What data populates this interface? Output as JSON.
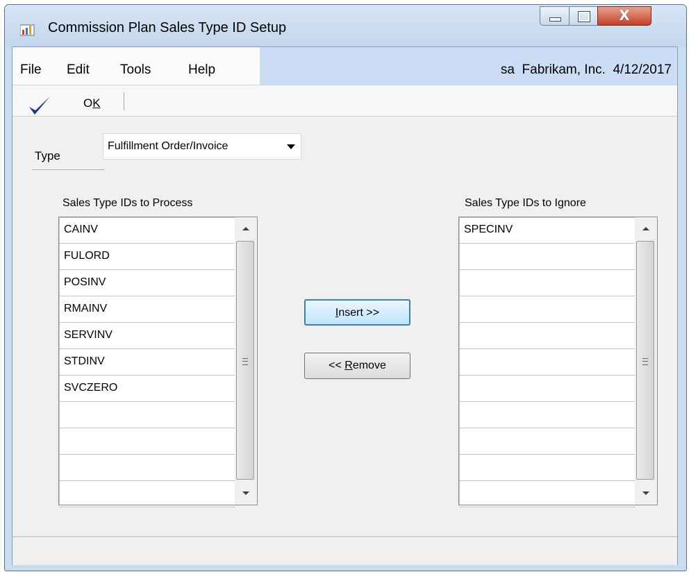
{
  "window": {
    "title": "Commission Plan Sales Type ID Setup",
    "close_glyph": "X",
    "icons": [
      "app-chart-icon",
      "minimize-icon",
      "maximize-icon",
      "close-icon"
    ]
  },
  "menu": {
    "items": [
      "File",
      "Edit",
      "Tools",
      "Help"
    ],
    "company_info": "sa  Fabrikam, Inc.  4/12/2017"
  },
  "toolbar": {
    "ok_label_prefix": "O",
    "ok_label_underlined": "K",
    "ok_icon": "checkmark-icon"
  },
  "form": {
    "type_label": "Type",
    "type_value": "Fulfillment Order/Invoice",
    "process_caption": "Sales Type IDs to Process",
    "ignore_caption": "Sales Type IDs to Ignore",
    "process_items": [
      "CAINV",
      "FULORD",
      "POSINV",
      "RMAINV",
      "SERVINV",
      "STDINV",
      "SVCZERO"
    ],
    "ignore_items": [
      "SPECINV"
    ],
    "insert_button": {
      "underlined": "I",
      "rest": "nsert >>"
    },
    "remove_button": {
      "prefix": "<< ",
      "underlined": "R",
      "rest": "emove"
    }
  },
  "colors": {
    "accent": "#cbdcf5",
    "focus_border": "#3c7fb1",
    "check": "#1b3a8c"
  }
}
